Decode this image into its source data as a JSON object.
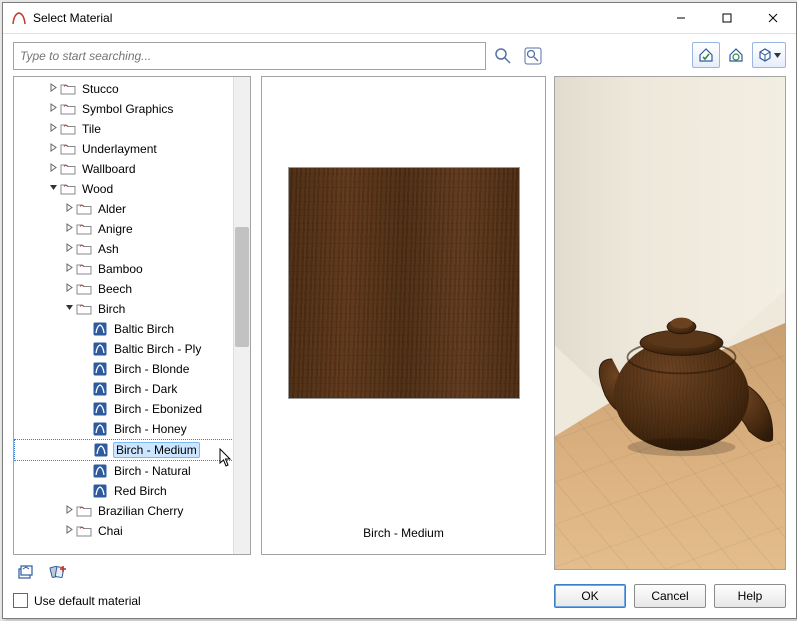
{
  "window": {
    "title": "Select Material"
  },
  "search": {
    "placeholder": "Type to start searching..."
  },
  "tree": {
    "items": [
      {
        "indent": 2,
        "twist": ">",
        "kind": "folder",
        "label": "Stucco"
      },
      {
        "indent": 2,
        "twist": ">",
        "kind": "folder",
        "label": "Symbol Graphics"
      },
      {
        "indent": 2,
        "twist": ">",
        "kind": "folder",
        "label": "Tile"
      },
      {
        "indent": 2,
        "twist": ">",
        "kind": "folder",
        "label": "Underlayment"
      },
      {
        "indent": 2,
        "twist": ">",
        "kind": "folder",
        "label": "Wallboard"
      },
      {
        "indent": 2,
        "twist": "v",
        "kind": "folder",
        "label": "Wood"
      },
      {
        "indent": 3,
        "twist": ">",
        "kind": "folder",
        "label": "Alder"
      },
      {
        "indent": 3,
        "twist": ">",
        "kind": "folder",
        "label": "Anigre"
      },
      {
        "indent": 3,
        "twist": ">",
        "kind": "folder",
        "label": "Ash"
      },
      {
        "indent": 3,
        "twist": ">",
        "kind": "folder",
        "label": "Bamboo"
      },
      {
        "indent": 3,
        "twist": ">",
        "kind": "folder",
        "label": "Beech"
      },
      {
        "indent": 3,
        "twist": "v",
        "kind": "folder",
        "label": "Birch"
      },
      {
        "indent": 4,
        "twist": "",
        "kind": "leaf",
        "label": "Baltic Birch"
      },
      {
        "indent": 4,
        "twist": "",
        "kind": "leaf",
        "label": "Baltic Birch - Ply"
      },
      {
        "indent": 4,
        "twist": "",
        "kind": "leaf",
        "label": "Birch - Blonde"
      },
      {
        "indent": 4,
        "twist": "",
        "kind": "leaf",
        "label": "Birch - Dark"
      },
      {
        "indent": 4,
        "twist": "",
        "kind": "leaf",
        "label": "Birch - Ebonized"
      },
      {
        "indent": 4,
        "twist": "",
        "kind": "leaf",
        "label": "Birch - Honey"
      },
      {
        "indent": 4,
        "twist": "",
        "kind": "leaf",
        "label": "Birch - Medium",
        "selected": true
      },
      {
        "indent": 4,
        "twist": "",
        "kind": "leaf",
        "label": "Birch - Natural"
      },
      {
        "indent": 4,
        "twist": "",
        "kind": "leaf",
        "label": "Red Birch"
      },
      {
        "indent": 3,
        "twist": ">",
        "kind": "folder",
        "label": "Brazilian Cherry"
      },
      {
        "indent": 3,
        "twist": ">",
        "kind": "folder",
        "label": "Chai"
      }
    ]
  },
  "swatch": {
    "caption": "Birch - Medium"
  },
  "options": {
    "use_default_material": "Use default material"
  },
  "buttons": {
    "ok": "OK",
    "cancel": "Cancel",
    "help": "Help"
  }
}
